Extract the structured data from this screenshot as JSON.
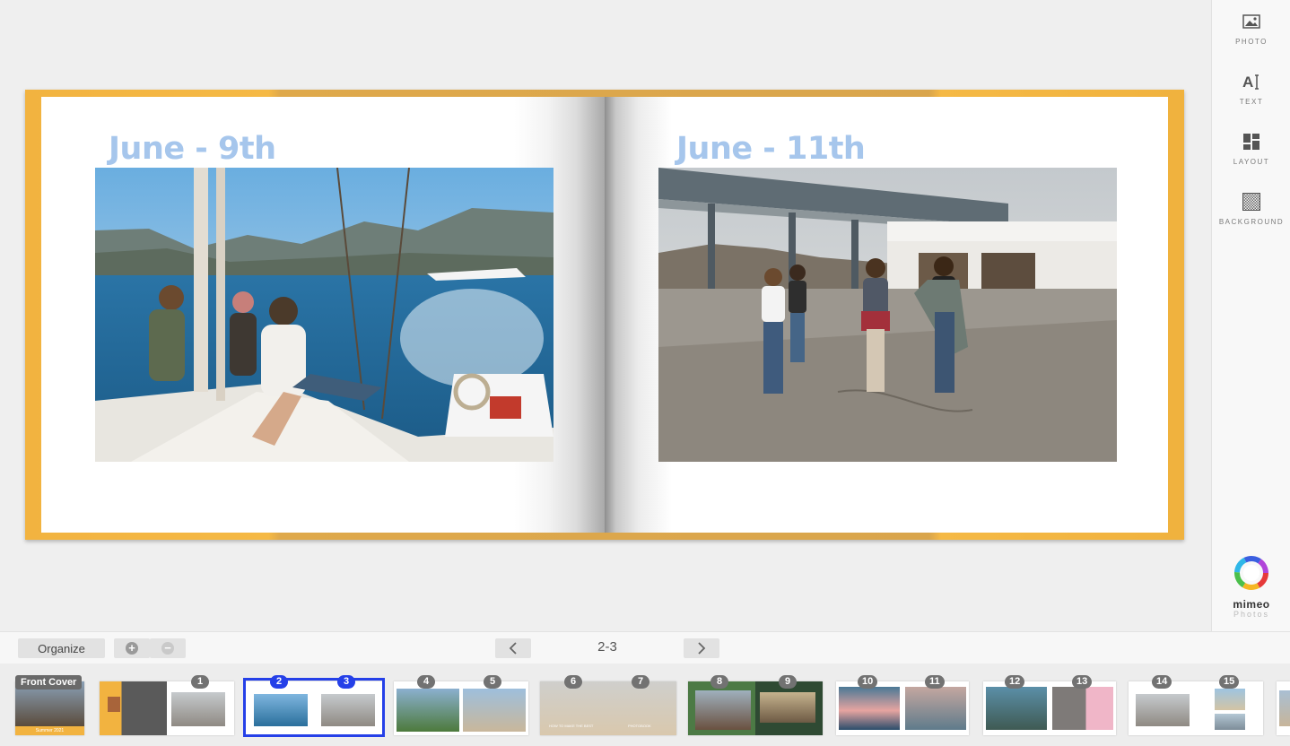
{
  "editor": {
    "left_page": {
      "heading": "June - 9th"
    },
    "right_page": {
      "heading": "June - 11th"
    }
  },
  "tools": [
    {
      "label": "PHOTO",
      "icon": "photo-icon"
    },
    {
      "label": "TEXT",
      "icon": "text-icon"
    },
    {
      "label": "LAYOUT",
      "icon": "layout-icon"
    },
    {
      "label": "BACKGROUND",
      "icon": "background-icon"
    }
  ],
  "brand": {
    "name": "mimeo",
    "sub": "Photos"
  },
  "toolbar": {
    "organize_label": "Organize",
    "page_indicator": "2-3",
    "add_icon": "plus-icon",
    "remove_icon": "minus-icon"
  },
  "thumbnails": {
    "front_cover_label": "Front Cover",
    "badges": [
      "1",
      "2",
      "3",
      "4",
      "5",
      "6",
      "7",
      "8",
      "9",
      "10",
      "11",
      "12",
      "13",
      "14",
      "15"
    ],
    "selected": [
      "2",
      "3"
    ],
    "cover_caption": "Summer 2021",
    "spread_captions": [
      "HOW TO MAKE THE BEST",
      "PHOTOBOOK"
    ]
  },
  "colors": {
    "accent": "#2540e8",
    "book_cover": "#f2b340",
    "heading": "#a6c6ec"
  }
}
